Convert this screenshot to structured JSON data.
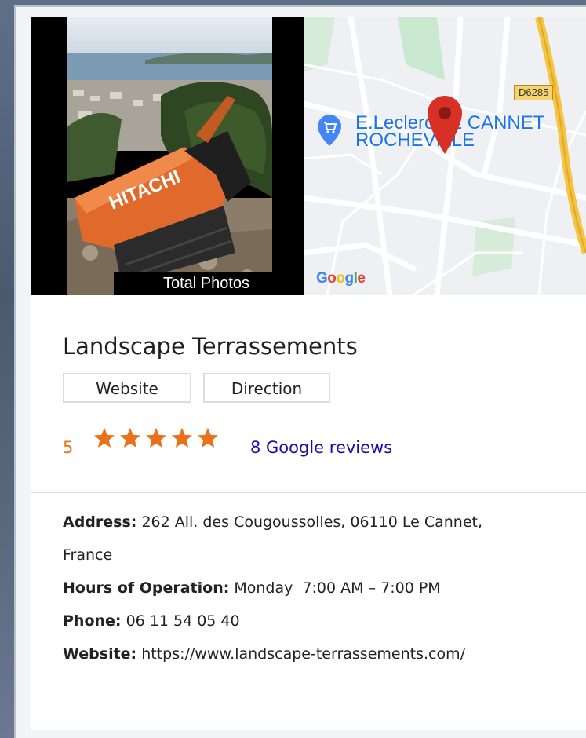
{
  "media": {
    "photo_caption": "Total Photos",
    "map": {
      "shop_label_line1": "E.Leclerc LE CANNET",
      "shop_label_line2": "ROCHEVILLE",
      "road_badge": "D6285",
      "attribution": "Google"
    }
  },
  "business": {
    "name": "Landscape Terrassements",
    "buttons": {
      "website": "Website",
      "direction": "Direction"
    },
    "rating": {
      "value": "5",
      "stars": 5,
      "reviews_link": "8 Google reviews"
    },
    "details": {
      "address_label": "Address:",
      "address_line1": "262 All. des Cougoussolles, 06110 Le Cannet,",
      "address_line2": "France",
      "hours_label": "Hours of Operation:",
      "hours_value": "Monday  7:00 AM – 7:00 PM",
      "phone_label": "Phone:",
      "phone_value": "06 11 54 05 40",
      "website_label": "Website:",
      "website_value": "https://www.landscape-terrassements.com/"
    }
  },
  "colors": {
    "accent_orange": "#e8711a",
    "link_blue": "#1a0dab",
    "map_pin_red": "#d93025"
  }
}
